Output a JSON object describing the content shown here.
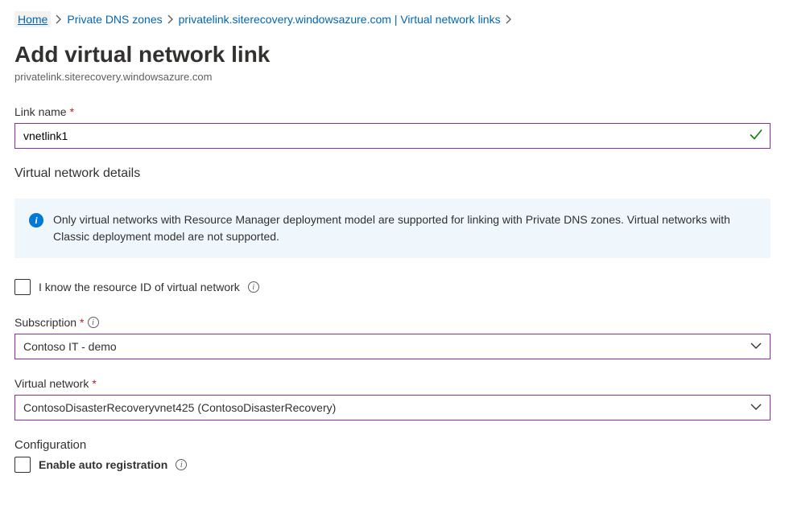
{
  "breadcrumb": {
    "home": "Home",
    "zones": "Private DNS zones",
    "zone_detail": "privatelink.siterecovery.windowsazure.com | Virtual network links"
  },
  "page": {
    "title": "Add virtual network link",
    "subtitle": "privatelink.siterecovery.windowsazure.com"
  },
  "form": {
    "link_name_label": "Link name",
    "link_name_value": "vnetlink1",
    "vnet_details_heading": "Virtual network details",
    "info_text": "Only virtual networks with Resource Manager deployment model are supported for linking with Private DNS zones. Virtual networks with Classic deployment model are not supported.",
    "know_resource_id_label": "I know the resource ID of virtual network",
    "subscription_label": "Subscription",
    "subscription_value": "Contoso IT - demo",
    "vnet_label": "Virtual network",
    "vnet_value": "ContosoDisasterRecoveryvnet425 (ContosoDisasterRecovery)",
    "config_heading": "Configuration",
    "auto_reg_label": "Enable auto registration"
  }
}
